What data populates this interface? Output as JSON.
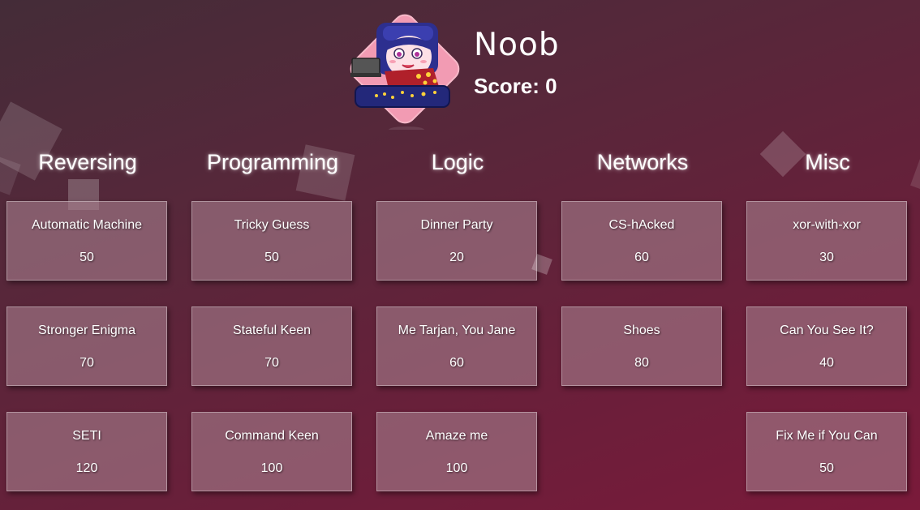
{
  "profile": {
    "name": "Noob",
    "score": "Score: 0"
  },
  "columns": [
    {
      "title": "Reversing",
      "challenges": [
        {
          "name": "Automatic Machine",
          "points": "50"
        },
        {
          "name": "Stronger Enigma",
          "points": "70"
        },
        {
          "name": "SETI",
          "points": "120"
        }
      ]
    },
    {
      "title": "Programming",
      "challenges": [
        {
          "name": "Tricky Guess",
          "points": "50"
        },
        {
          "name": "Stateful Keen",
          "points": "70"
        },
        {
          "name": "Command Keen",
          "points": "100"
        }
      ]
    },
    {
      "title": "Logic",
      "challenges": [
        {
          "name": "Dinner Party",
          "points": "20"
        },
        {
          "name": "Me Tarjan, You Jane",
          "points": "60"
        },
        {
          "name": "Amaze me",
          "points": "100"
        }
      ]
    },
    {
      "title": "Networks",
      "challenges": [
        {
          "name": "CS-hAcked",
          "points": "60"
        },
        {
          "name": "Shoes",
          "points": "80"
        }
      ]
    },
    {
      "title": "Misc",
      "challenges": [
        {
          "name": "xor-with-xor",
          "points": "30"
        },
        {
          "name": "Can You See It?",
          "points": "40"
        },
        {
          "name": "Fix Me if You Can",
          "points": "50"
        }
      ]
    }
  ]
}
